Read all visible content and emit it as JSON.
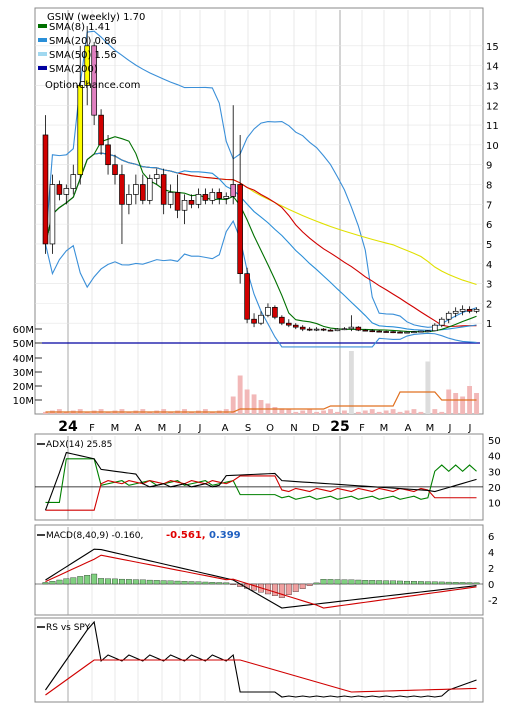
{
  "chart_data": [
    {
      "type": "candlestick",
      "title": "GSIW (weekly) 1.70",
      "watermark": "OptionChance.com",
      "x_axis_labels": [
        "24",
        "F",
        "M",
        "A",
        "M",
        "J",
        "J",
        "A",
        "S",
        "O",
        "N",
        "D",
        "25",
        "F",
        "M",
        "A",
        "M",
        "J",
        "J"
      ],
      "y_ticks_right": [
        1,
        2,
        3,
        4,
        5,
        6,
        7,
        8,
        9,
        10,
        11,
        12,
        13,
        14,
        15
      ],
      "y_range": [
        0,
        16
      ],
      "grid": true,
      "legend": [
        {
          "label": "SMA(8) 1.41",
          "color": "#007000"
        },
        {
          "label": "SMA(20) 0.86",
          "color": "#2a8fd8"
        },
        {
          "label": "SMA(50) 1.56",
          "color": "#e0e000"
        },
        {
          "label": "SMA(200)",
          "color": "#0000a0"
        }
      ],
      "candles": [
        [
          10.5,
          11.5,
          4.5,
          5.0
        ],
        [
          5.0,
          8.5,
          4.5,
          8.0
        ],
        [
          8.0,
          8.2,
          7.2,
          7.5
        ],
        [
          7.5,
          8.0,
          7.0,
          7.8
        ],
        [
          7.8,
          9.0,
          7.5,
          8.5
        ],
        [
          8.5,
          15.0,
          8.0,
          13.0
        ],
        [
          13.0,
          16.0,
          12.0,
          15.0
        ],
        [
          15.0,
          15.2,
          11.0,
          11.5
        ],
        [
          11.5,
          11.8,
          9.5,
          10.0
        ],
        [
          10.0,
          10.5,
          8.5,
          9.0
        ],
        [
          9.0,
          9.5,
          8.0,
          8.5
        ],
        [
          8.5,
          9.0,
          5.0,
          7.0
        ],
        [
          7.0,
          8.0,
          6.5,
          7.5
        ],
        [
          7.5,
          8.5,
          7.0,
          8.0
        ],
        [
          8.0,
          8.5,
          7.0,
          7.2
        ],
        [
          7.2,
          8.5,
          7.0,
          8.3
        ],
        [
          8.3,
          8.8,
          8.0,
          8.5
        ],
        [
          8.5,
          8.8,
          6.5,
          7.0
        ],
        [
          7.0,
          8.0,
          6.8,
          7.6
        ],
        [
          7.6,
          8.5,
          6.3,
          6.7
        ],
        [
          6.7,
          7.5,
          6.0,
          7.2
        ],
        [
          7.2,
          7.5,
          6.8,
          7.0
        ],
        [
          7.0,
          7.8,
          6.8,
          7.5
        ],
        [
          7.5,
          7.8,
          7.0,
          7.2
        ],
        [
          7.2,
          7.8,
          7.0,
          7.6
        ],
        [
          7.6,
          7.8,
          7.0,
          7.3
        ],
        [
          7.3,
          7.6,
          7.0,
          7.4
        ],
        [
          7.4,
          12.0,
          7.0,
          8.0
        ],
        [
          8.0,
          10.5,
          3.0,
          3.5
        ],
        [
          3.5,
          3.8,
          1.0,
          1.2
        ],
        [
          1.2,
          1.5,
          0.8,
          1.0
        ],
        [
          1.0,
          1.6,
          0.9,
          1.4
        ],
        [
          1.4,
          2.0,
          1.3,
          1.8
        ],
        [
          1.8,
          1.9,
          1.2,
          1.3
        ],
        [
          1.3,
          1.4,
          0.9,
          1.0
        ],
        [
          1.0,
          1.2,
          0.8,
          0.9
        ],
        [
          0.9,
          1.0,
          0.7,
          0.8
        ],
        [
          0.8,
          0.9,
          0.6,
          0.7
        ],
        [
          0.7,
          0.8,
          0.6,
          0.65
        ],
        [
          0.65,
          0.8,
          0.6,
          0.7
        ],
        [
          0.7,
          0.75,
          0.6,
          0.65
        ],
        [
          0.65,
          0.7,
          0.6,
          0.62
        ],
        [
          0.62,
          0.75,
          0.6,
          0.7
        ],
        [
          0.7,
          0.8,
          0.65,
          0.72
        ],
        [
          0.72,
          1.4,
          0.6,
          0.8
        ],
        [
          0.8,
          0.85,
          0.6,
          0.65
        ],
        [
          0.65,
          0.7,
          0.6,
          0.62
        ],
        [
          0.62,
          0.7,
          0.55,
          0.6
        ],
        [
          0.6,
          0.65,
          0.55,
          0.58
        ],
        [
          0.58,
          0.62,
          0.55,
          0.57
        ],
        [
          0.57,
          0.6,
          0.5,
          0.55
        ],
        [
          0.55,
          0.6,
          0.5,
          0.53
        ],
        [
          0.53,
          0.58,
          0.5,
          0.55
        ],
        [
          0.55,
          0.6,
          0.5,
          0.57
        ],
        [
          0.57,
          0.62,
          0.55,
          0.6
        ],
        [
          0.6,
          0.65,
          0.55,
          0.62
        ],
        [
          0.62,
          1.0,
          0.6,
          0.9
        ],
        [
          0.9,
          1.3,
          0.8,
          1.2
        ],
        [
          1.2,
          1.6,
          1.0,
          1.5
        ],
        [
          1.5,
          1.8,
          1.3,
          1.6
        ],
        [
          1.6,
          1.9,
          1.4,
          1.7
        ],
        [
          1.7,
          1.85,
          1.5,
          1.6
        ],
        [
          1.6,
          1.8,
          1.5,
          1.7
        ]
      ],
      "volume_axis_labels": [
        "10M",
        "20M",
        "30M",
        "40M",
        "50M",
        "60M"
      ]
    },
    {
      "type": "line",
      "title": "ADX(14) 25.85",
      "y_ticks_right": [
        10,
        20,
        30,
        40,
        50
      ],
      "y_range": [
        0,
        52
      ],
      "reference_line": 20
    },
    {
      "type": "histogram",
      "title": "MACD(8,40,9) -0.160,",
      "values_printed": [
        "-0.561,",
        "0.399"
      ],
      "value_colors": [
        "#e00000",
        "#2060c0"
      ],
      "y_ticks_right": [
        -2,
        0,
        2,
        4,
        6
      ],
      "y_range": [
        -3.5,
        7
      ]
    },
    {
      "type": "line",
      "title": "RS vs SPY"
    }
  ],
  "colors": {
    "up_candle": "#ffffff",
    "down_candle": "#d00000",
    "gap_up": "#ffff00",
    "gap_down": "#e080c0",
    "sma8": "#007000",
    "sma20": "#2a8fd8",
    "sma50": "#e0e000",
    "sma200": "#d00000",
    "bollinger": "#3a8fd8",
    "adx_pos": "#008000",
    "adx_neg": "#d00000",
    "volume": "#f2b8b8",
    "volume_avg": "#e07020",
    "hist_pos": "#80d080",
    "hist_neg": "#f0a0a0"
  }
}
